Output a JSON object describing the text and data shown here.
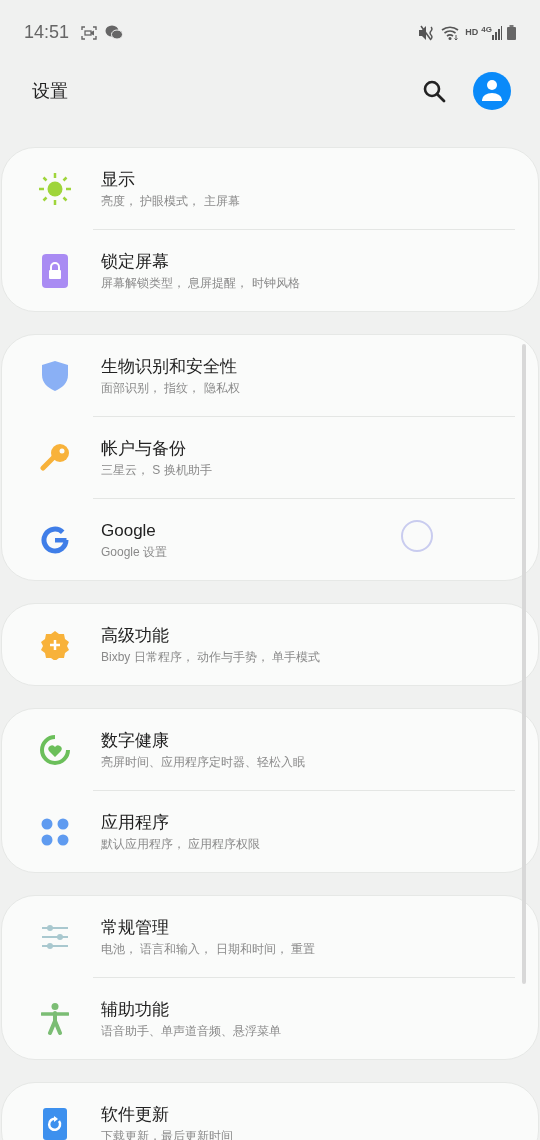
{
  "status_bar": {
    "time": "14:51",
    "hd": "HD",
    "network": "4G"
  },
  "header": {
    "title": "设置"
  },
  "groups": [
    {
      "items": [
        {
          "title": "显示",
          "subtitle": "亮度， 护眼模式， 主屏幕"
        },
        {
          "title": "锁定屏幕",
          "subtitle": "屏幕解锁类型， 息屏提醒， 时钟风格"
        }
      ]
    },
    {
      "items": [
        {
          "title": "生物识别和安全性",
          "subtitle": "面部识别， 指纹， 隐私权"
        },
        {
          "title": "帐户与备份",
          "subtitle": "三星云， S 换机助手"
        },
        {
          "title": "Google",
          "subtitle": "Google 设置"
        }
      ]
    },
    {
      "items": [
        {
          "title": "高级功能",
          "subtitle": "Bixby 日常程序， 动作与手势， 单手模式"
        }
      ]
    },
    {
      "items": [
        {
          "title": "数字健康",
          "subtitle": "亮屏时间、应用程序定时器、轻松入眠"
        },
        {
          "title": "应用程序",
          "subtitle": "默认应用程序， 应用程序权限"
        }
      ]
    },
    {
      "items": [
        {
          "title": "常规管理",
          "subtitle": "电池， 语言和输入， 日期和时间， 重置"
        },
        {
          "title": "辅助功能",
          "subtitle": "语音助手、单声道音频、悬浮菜单"
        }
      ]
    },
    {
      "items": [
        {
          "title": "软件更新",
          "subtitle": "下载更新，最后更新时间"
        }
      ]
    }
  ]
}
